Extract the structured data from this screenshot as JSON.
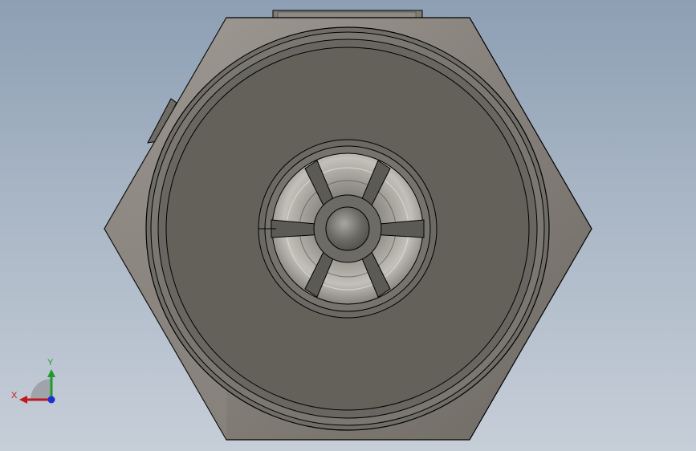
{
  "viewport": {
    "view": "cad-3d-model-front-view"
  },
  "triad": {
    "x_label": "X",
    "y_label": "Y",
    "x_color": "#c0181c",
    "y_color": "#1f9a2c",
    "z_color": "#1d2fd0"
  },
  "colors": {
    "background_top": "#8d9fb4",
    "background_bottom": "#c6ced8",
    "hex_body": "#8a8580",
    "face": "#636159",
    "outline": "#000000"
  }
}
